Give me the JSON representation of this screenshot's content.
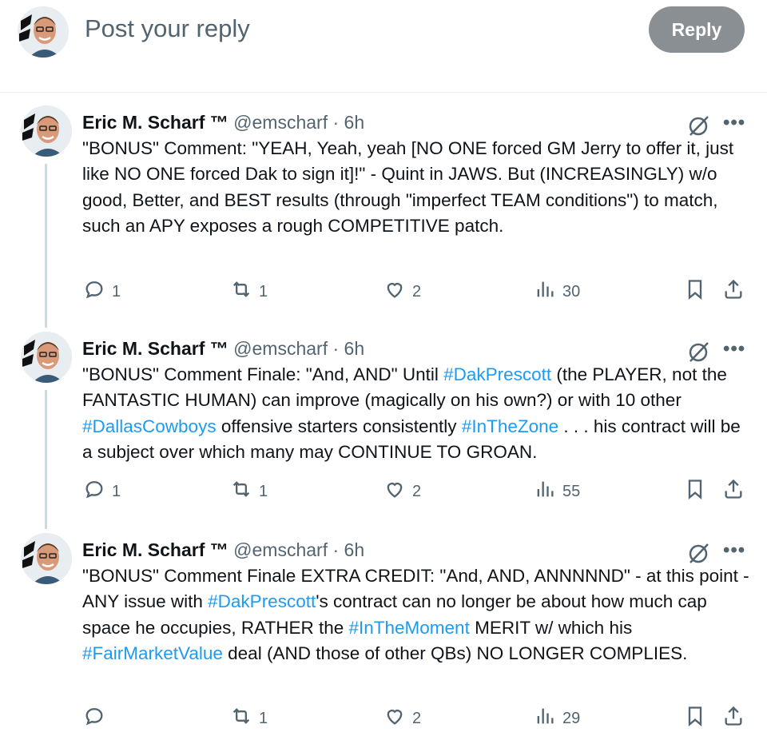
{
  "composer": {
    "placeholder": "Post your reply",
    "reply_label": "Reply"
  },
  "colors": {
    "accent": "#1d9bf0",
    "muted": "#536471",
    "reply_button": "#8a8f94"
  },
  "tweets": [
    {
      "name": "Eric M. Scharf ™",
      "handle": "@emscharf",
      "time": "· 6h",
      "text_parts": [
        {
          "t": "\"BONUS\" Comment: \"YEAH, Yeah, yeah [NO ONE forced GM Jerry to offer it, just like NO ONE forced Dak to sign it]!\" - Quint in JAWS. But (INCREASINGLY) w/o good, Better, and BEST results (through \"imperfect TEAM conditions\") to match, such an APY exposes a rough COMPETITIVE patch."
        }
      ],
      "replies": "1",
      "reposts": "1",
      "likes": "2",
      "views": "30"
    },
    {
      "name": "Eric M. Scharf ™",
      "handle": "@emscharf",
      "time": "· 6h",
      "text_parts": [
        {
          "t": "\"BONUS\" Comment Finale: \"And, AND\" Until "
        },
        {
          "t": "#DakPrescott",
          "tag": true
        },
        {
          "t": " (the PLAYER, not the FANTASTIC HUMAN) can improve (magically on his own?) or with 10 other "
        },
        {
          "t": "#DallasCowboys",
          "tag": true
        },
        {
          "t": " offensive starters consistently "
        },
        {
          "t": "#InTheZone",
          "tag": true
        },
        {
          "t": " . . . his contract will be a subject over which many may CONTINUE TO GROAN."
        }
      ],
      "replies": "1",
      "reposts": "1",
      "likes": "2",
      "views": "55"
    },
    {
      "name": "Eric M. Scharf ™",
      "handle": "@emscharf",
      "time": "· 6h",
      "text_parts": [
        {
          "t": "\"BONUS\" Comment Finale EXTRA CREDIT: \"And, AND, ANNNNND\" - at this point - ANY issue with "
        },
        {
          "t": "#DakPrescott",
          "tag": true
        },
        {
          "t": "'s contract can no longer be about how much cap space he occupies, RATHER the "
        },
        {
          "t": "#InTheMoment",
          "tag": true
        },
        {
          "t": " MERIT w/ which his "
        },
        {
          "t": "#FairMarketValue",
          "tag": true
        },
        {
          "t": " deal (AND those of other QBs) NO LONGER COMPLIES."
        }
      ],
      "replies": "",
      "reposts": "1",
      "likes": "2",
      "views": "29"
    }
  ]
}
